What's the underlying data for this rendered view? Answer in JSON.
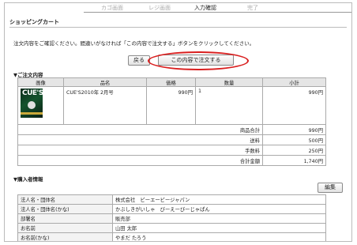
{
  "steps": [
    "カゴ画面",
    "レジ画面",
    "入力確認",
    "完了"
  ],
  "active_step": "入力確認",
  "page_title": "ショッピングカート",
  "instruction": "注文内容をご確認ください。間違いがなければ「この内容で注文する」ボタンをクリックしてください。",
  "buttons": {
    "back": "戻る",
    "order": "この内容で注文する",
    "edit": "編集"
  },
  "order_section": {
    "heading": "▼ご注文内容",
    "columns": [
      "画像",
      "品名",
      "価格",
      "数量",
      "小計"
    ],
    "rows": [
      {
        "image": "cues-magazine-cover",
        "name": "CUE'S2010年 2月号",
        "price": "990円",
        "qty": "1",
        "subtotal": "990円"
      }
    ],
    "cover_text": "CUE'S",
    "totals": [
      {
        "label": "商品合計",
        "value": "990円"
      },
      {
        "label": "送料",
        "value": "500円"
      },
      {
        "label": "手数料",
        "value": "250円"
      },
      {
        "label": "合計金額",
        "value": "1,740円"
      }
    ]
  },
  "buyer_section": {
    "heading": "▼購入者情報",
    "rows": [
      {
        "label": "法人名・団体名",
        "value": "株式会社　ビーエービージャパン"
      },
      {
        "label": "法人名・団体名(かな)",
        "value": "かぶしきがいしゃ　びーえーびーじゃぱん"
      },
      {
        "label": "部署名",
        "value": "販売部"
      },
      {
        "label": "お名前",
        "value": "山田 太郎"
      },
      {
        "label": "お名前(かな)",
        "value": "やまだ たろう"
      }
    ]
  },
  "colors": {
    "highlight": "#d91f1f",
    "header_bg": "#e5e5e5"
  }
}
